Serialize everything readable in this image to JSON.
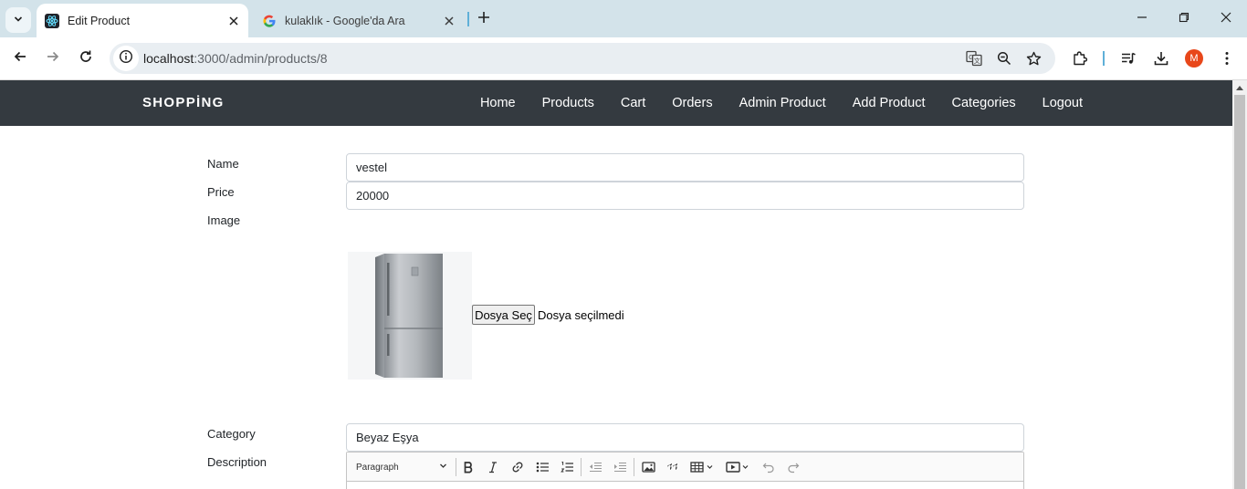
{
  "browser": {
    "tabs": [
      {
        "title": "Edit Product",
        "active": true,
        "favicon": "react-icon"
      },
      {
        "title": "kulaklık - Google'da Ara",
        "active": false,
        "favicon": "google-icon"
      }
    ],
    "address": {
      "host": "localhost",
      "path": ":3000/admin/products/8"
    },
    "profile_initial": "M"
  },
  "navbar": {
    "brand": "SHOPPİNG",
    "links": [
      "Home",
      "Products",
      "Cart",
      "Orders",
      "Admin Product",
      "Add Product",
      "Categories",
      "Logout"
    ]
  },
  "form": {
    "name_label": "Name",
    "name_value": "vestel",
    "price_label": "Price",
    "price_value": "20000",
    "image_label": "Image",
    "image_alt": "refrigerator-image",
    "file_button": "Dosya Seç",
    "file_status": "Dosya seçilmedi",
    "category_label": "Category",
    "category_value": "Beyaz Eşya",
    "description_label": "Description",
    "editor": {
      "heading_select": "Paragraph",
      "tools": [
        "bold-icon",
        "italic-icon",
        "link-icon",
        "bulleted-list-icon",
        "numbered-list-icon",
        "outdent-icon",
        "indent-icon",
        "image-icon",
        "blockquote-icon",
        "table-icon",
        "media-icon",
        "undo-icon",
        "redo-icon"
      ]
    }
  },
  "colors": {
    "navbar_bg": "#343a40",
    "tab_strip_bg": "#d3e3ea",
    "avatar_bg": "#e8471a"
  }
}
